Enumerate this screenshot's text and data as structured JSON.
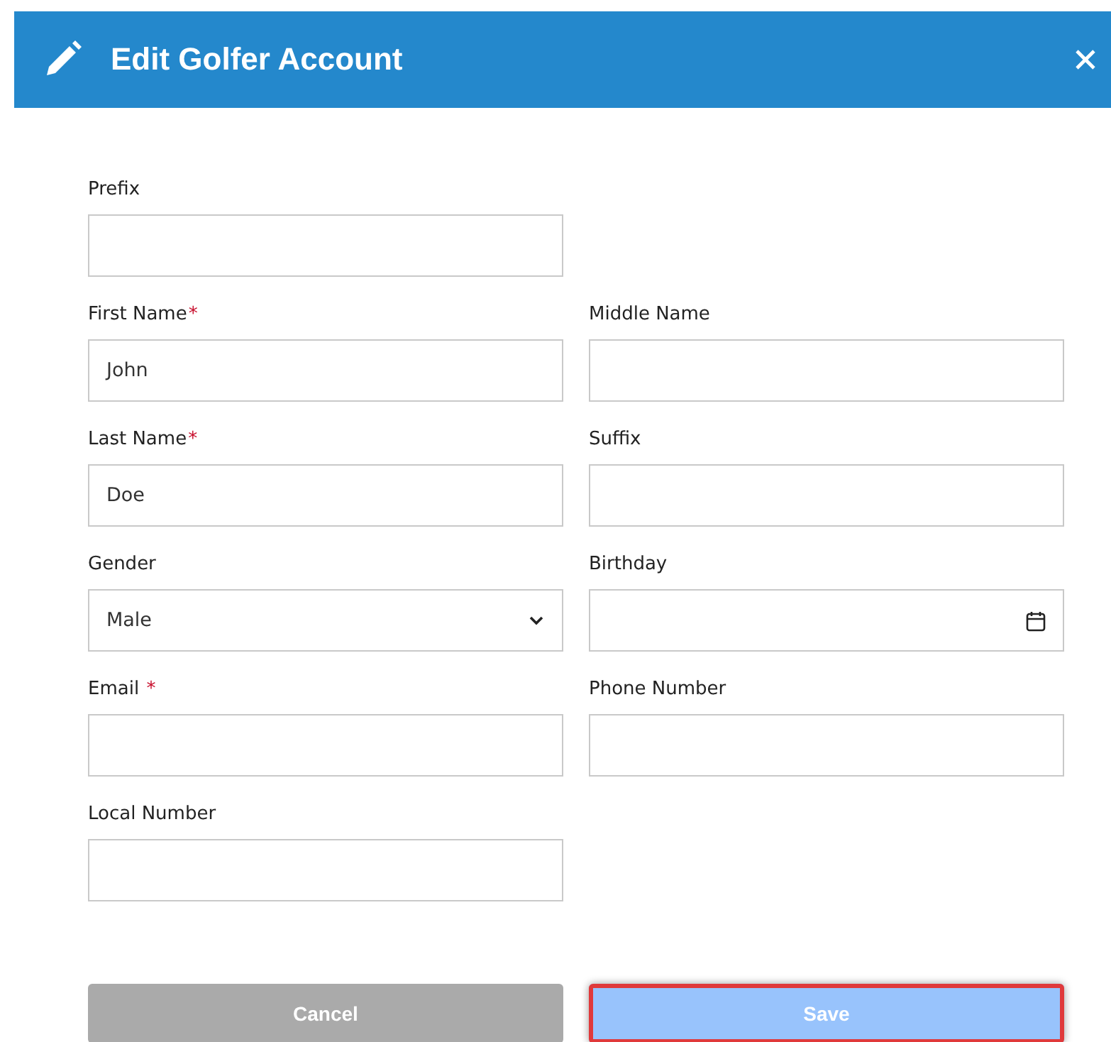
{
  "dialog": {
    "title": "Edit Golfer Account"
  },
  "rows": [
    [
      {
        "label": "Prefix",
        "kind": "text"
      }
    ],
    [
      {
        "label": "First Name",
        "marker": "*",
        "kind": "text",
        "value": "John"
      },
      {
        "label": "Middle Name",
        "kind": "text"
      }
    ],
    [
      {
        "label": "Last Name",
        "marker": "*",
        "kind": "text",
        "value": "Doe"
      },
      {
        "label": "Suffix",
        "kind": "text"
      }
    ],
    [
      {
        "label": "Gender",
        "kind": "select",
        "value": "Male"
      },
      {
        "label": "Birthday",
        "kind": "date"
      }
    ],
    [
      {
        "label": "Email",
        "marker": " *",
        "kind": "text"
      },
      {
        "label": "Phone Number",
        "kind": "text"
      }
    ],
    [
      {
        "label": "Local Number",
        "kind": "text"
      }
    ]
  ],
  "buttons": [
    {
      "label": "Cancel",
      "kind": "cancel",
      "highlighted": false
    },
    {
      "label": "Save",
      "kind": "save",
      "highlighted": true
    }
  ]
}
